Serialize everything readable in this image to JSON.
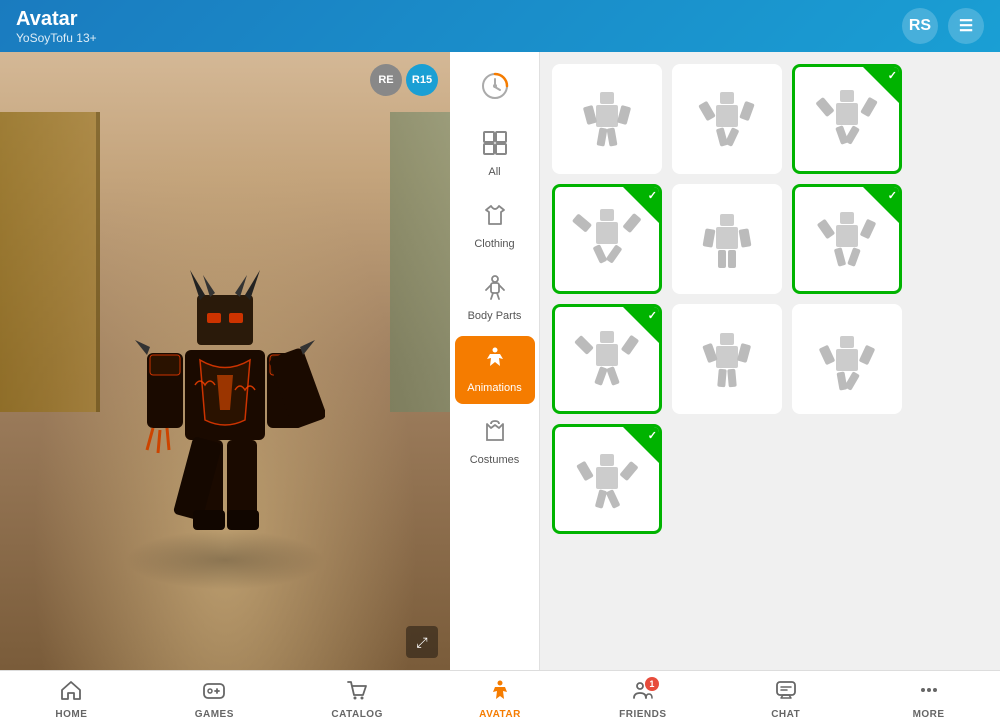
{
  "header": {
    "title": "Avatar",
    "subtitle": "YoSoyTofu 13+",
    "robux_icon": "RS",
    "menu_icon": "☰"
  },
  "avatar_viewer": {
    "badge_re": "RE",
    "badge_r15": "R15",
    "expand_icon": "⤢"
  },
  "sidebar": {
    "items": [
      {
        "id": "recent",
        "label": "Recent",
        "icon": "🕐"
      },
      {
        "id": "all",
        "label": "All",
        "icon": "⧉"
      },
      {
        "id": "clothing",
        "label": "Clothing",
        "icon": "👕"
      },
      {
        "id": "body-parts",
        "label": "Body Parts",
        "icon": "🧍"
      },
      {
        "id": "animations",
        "label": "Animations",
        "icon": "🏃",
        "active": true
      },
      {
        "id": "costumes",
        "label": "Costumes",
        "icon": "🎭"
      }
    ]
  },
  "animation_grid": {
    "cards": [
      {
        "selected": false,
        "id": "anim1"
      },
      {
        "selected": false,
        "id": "anim2"
      },
      {
        "selected": true,
        "id": "anim3"
      },
      {
        "selected": true,
        "id": "anim4"
      },
      {
        "selected": false,
        "id": "anim5"
      },
      {
        "selected": true,
        "id": "anim6"
      },
      {
        "selected": true,
        "id": "anim7"
      },
      {
        "selected": false,
        "id": "anim8"
      },
      {
        "selected": false,
        "id": "anim9"
      },
      {
        "selected": true,
        "id": "anim10"
      }
    ]
  },
  "footer": {
    "items": [
      {
        "id": "home",
        "label": "HOME",
        "icon": "⌂",
        "active": false
      },
      {
        "id": "games",
        "label": "GAMES",
        "icon": "🎮",
        "active": false
      },
      {
        "id": "catalog",
        "label": "CATALOG",
        "icon": "🛒",
        "active": false
      },
      {
        "id": "avatar",
        "label": "AVATAR",
        "icon": "🏃",
        "active": true
      },
      {
        "id": "friends",
        "label": "FRIENDS",
        "icon": "👥",
        "active": false,
        "badge": "1"
      },
      {
        "id": "chat",
        "label": "CHAT",
        "icon": "💬",
        "active": false
      },
      {
        "id": "more",
        "label": "MORE",
        "icon": "···",
        "active": false
      }
    ]
  }
}
